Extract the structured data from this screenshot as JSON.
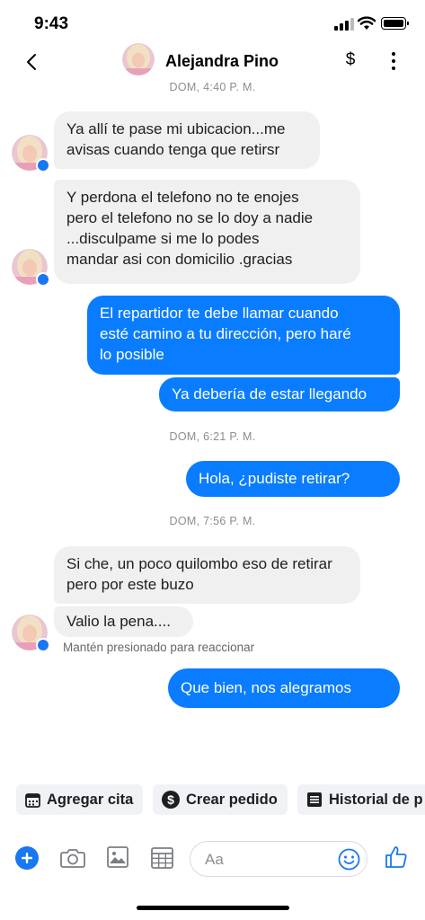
{
  "status": {
    "time": "9:43"
  },
  "header": {
    "contact_name": "Alejandra Pino",
    "dollar_label": "$"
  },
  "timestamps": [
    "DOM, 4:40 P. M.",
    "DOM, 6:21 P. M.",
    "DOM, 7:56 P. M."
  ],
  "messages": [
    {
      "from": "contact",
      "text": "Ya allí te pase mi ubicacion...me\navisas cuando tenga que retirsr"
    },
    {
      "from": "contact",
      "text": "Y perdona el telefono  no te enojes\npero el telefono no se lo doy a nadie\n...disculpame si me lo podes\nmandar asi con domicilio  .gracias"
    },
    {
      "from": "me",
      "text": "El repartidor te debe llamar cuando\nesté camino a tu dirección, pero haré\nlo posible"
    },
    {
      "from": "me",
      "text": "Ya debería de estar llegando"
    },
    {
      "from": "me",
      "text": "Hola, ¿pudiste retirar?"
    },
    {
      "from": "contact",
      "text": "Si che, un poco quilombo eso de retirar\npero por este buzo"
    },
    {
      "from": "contact",
      "text": "Valio la pena...."
    },
    {
      "from": "me",
      "text": "Que bien, nos alegramos"
    }
  ],
  "reaction_hint": "Mantén presionado para reaccionar",
  "quick_actions": [
    {
      "label": "Agregar cita",
      "icon": "calendar-icon"
    },
    {
      "label": "Crear pedido",
      "icon": "dollar-circle-icon"
    },
    {
      "label": "Historial de p",
      "icon": "list-icon"
    }
  ],
  "composer": {
    "placeholder": "Aa"
  },
  "colors": {
    "outgoing": "#0a7cff",
    "incoming": "#f0f0f0",
    "accent": "#1877f2"
  }
}
